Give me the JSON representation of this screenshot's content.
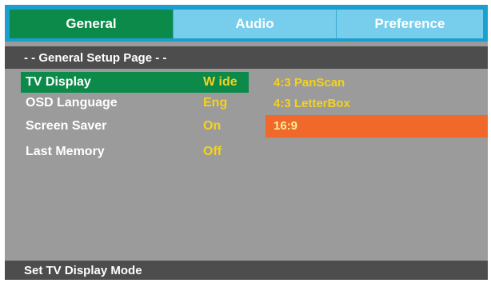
{
  "tabs": [
    {
      "label": "General"
    },
    {
      "label": "Audio"
    },
    {
      "label": "Preference"
    }
  ],
  "page_title": "- - General Setup Page - -",
  "settings": [
    {
      "label": "TV Display",
      "value": "W ide"
    },
    {
      "label": "OSD Language",
      "value": "Eng"
    },
    {
      "label": "Screen Saver",
      "value": "On"
    },
    {
      "label": "Last Memory",
      "value": "Off"
    }
  ],
  "options": [
    {
      "label": "4:3 PanScan"
    },
    {
      "label": "4:3 LetterBox"
    },
    {
      "label": "16:9"
    }
  ],
  "status": "Set TV Display Mode",
  "colors": {
    "tab_bar": "#1b9fcf",
    "active_tab": "#0b8a4a",
    "inactive_tab": "#77cdec",
    "panel": "#9b9b9b",
    "header_bar": "#4d4d4d",
    "value_text": "#f5d21d",
    "highlight": "#f0682a"
  }
}
